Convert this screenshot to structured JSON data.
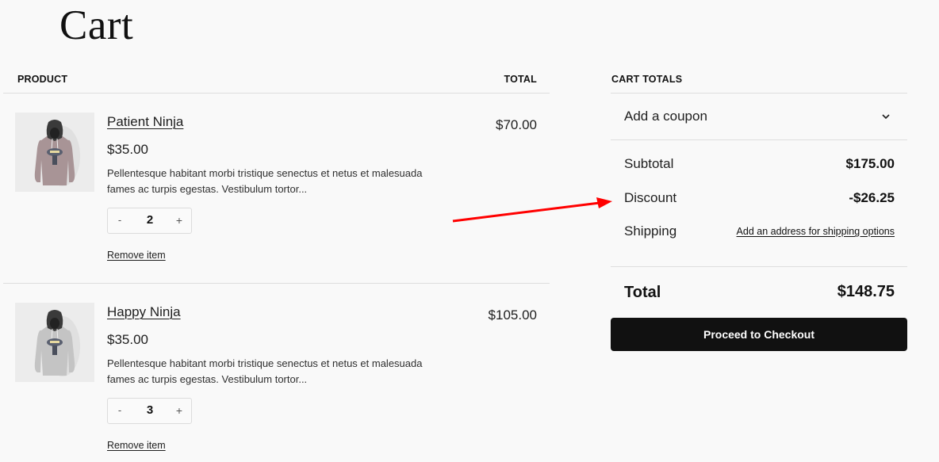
{
  "page": {
    "title": "Cart"
  },
  "products_table": {
    "header_product": "PRODUCT",
    "header_total": "TOTAL",
    "items": [
      {
        "name": "Patient Ninja",
        "price": "$35.00",
        "description": "Pellentesque habitant morbi tristique senectus et netus et malesuada fames ac turpis egestas. Vestibulum tortor...",
        "quantity": "2",
        "decrement_label": "-",
        "increment_label": "+",
        "remove_label": "Remove item",
        "line_total": "$70.00",
        "image_icon": "hoodie-image",
        "hoodie_color": "#a89496"
      },
      {
        "name": "Happy Ninja",
        "price": "$35.00",
        "description": "Pellentesque habitant morbi tristique senectus et netus et malesuada fames ac turpis egestas. Vestibulum tortor...",
        "quantity": "3",
        "decrement_label": "-",
        "increment_label": "+",
        "remove_label": "Remove item",
        "line_total": "$105.00",
        "image_icon": "hoodie-image",
        "hoodie_color": "#c4c4c4"
      }
    ]
  },
  "cart_totals": {
    "header": "CART TOTALS",
    "coupon_label": "Add a coupon",
    "coupon_icon": "chevron-down-icon",
    "subtotal_label": "Subtotal",
    "subtotal_value": "$175.00",
    "discount_label": "Discount",
    "discount_value": "-$26.25",
    "shipping_label": "Shipping",
    "shipping_link": "Add an address for shipping options",
    "total_label": "Total",
    "total_value": "$148.75",
    "checkout_label": "Proceed to Checkout"
  },
  "annotation": {
    "arrow_color": "#ff0000",
    "points_to": "Discount"
  }
}
